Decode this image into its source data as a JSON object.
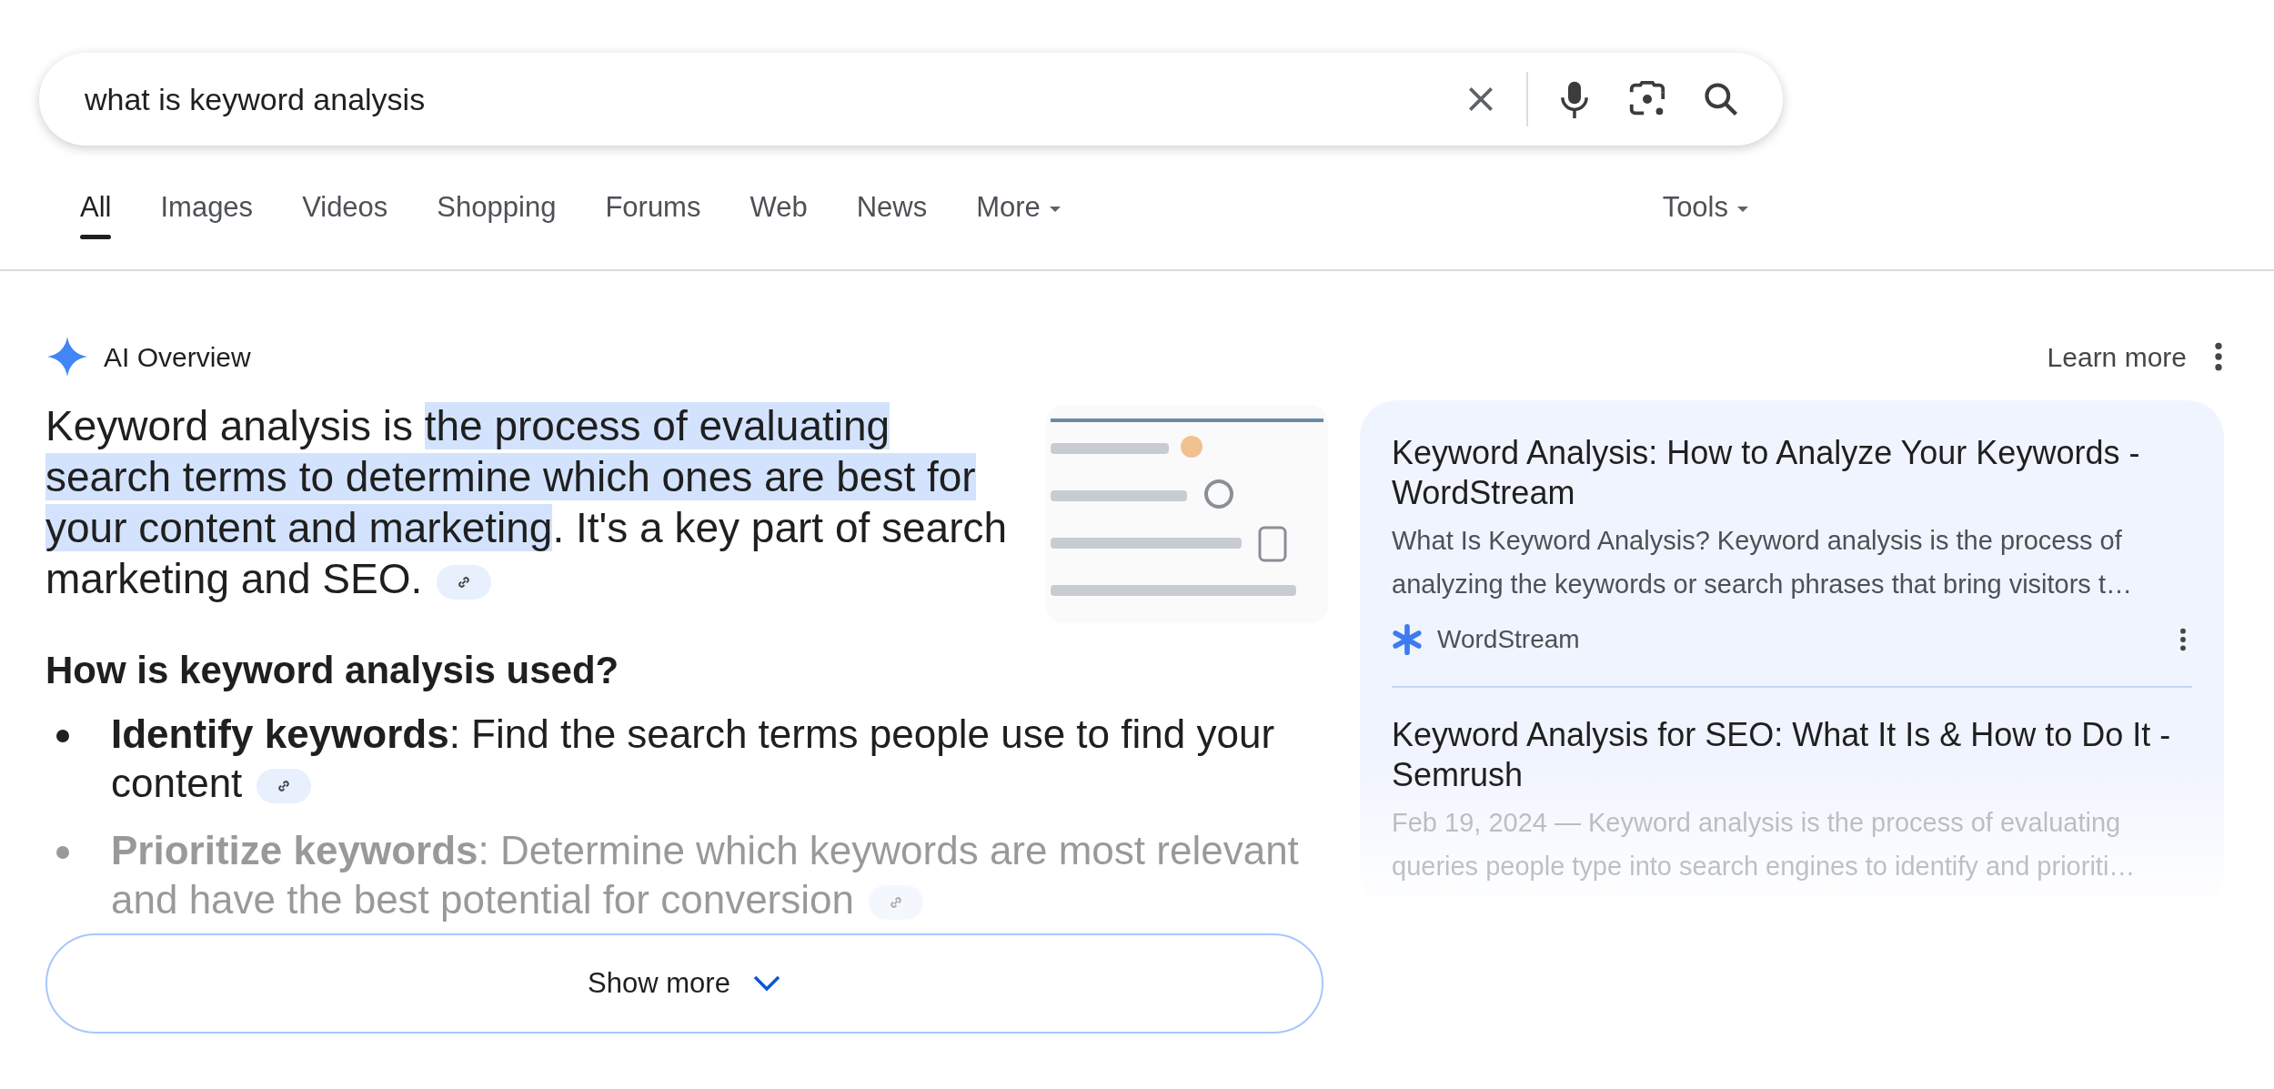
{
  "search": {
    "value": "what is keyword analysis"
  },
  "tabs": [
    {
      "label": "All",
      "selected": true,
      "kind": "plain"
    },
    {
      "label": "Images",
      "selected": false,
      "kind": "plain"
    },
    {
      "label": "Videos",
      "selected": false,
      "kind": "plain"
    },
    {
      "label": "Shopping",
      "selected": false,
      "kind": "plain"
    },
    {
      "label": "Forums",
      "selected": false,
      "kind": "plain"
    },
    {
      "label": "Web",
      "selected": false,
      "kind": "plain"
    },
    {
      "label": "News",
      "selected": false,
      "kind": "plain"
    },
    {
      "label": "More",
      "selected": false,
      "kind": "dropdown"
    }
  ],
  "tools": {
    "label": "Tools"
  },
  "ai_overview": {
    "title": "AI Overview",
    "learn_more": "Learn more",
    "summary": [
      {
        "text": "Keyword analysis is ",
        "highlighted": false
      },
      {
        "text": "the process of evaluating search terms to determine which ones are best for your content and marketing",
        "highlighted": true
      },
      {
        "text": ". It's a key part of search marketing and SEO.",
        "highlighted": false
      }
    ],
    "heading": "How is keyword analysis used?",
    "bullets": [
      "**Identify keywords**: Find the search terms people use to find your content",
      "**Prioritize keywords**: Determine which keywords are most relevant and have the best potential for conversion"
    ],
    "show_more": "Show more",
    "sources": [
      {
        "title": "Keyword Analysis: How to Analyze Your Keywords - WordStream",
        "snippet": "What Is Keyword Analysis? Keyword analysis is the process of analyzing the keywords or search phrases that bring visitors t…",
        "site": "WordStream"
      },
      {
        "title": "Keyword Analysis for SEO: What It Is & How to Do It - Semrush",
        "snippet": "Feb 19, 2024 — Keyword analysis is the process of evaluating queries people type into search engines to identify and prioriti…"
      }
    ]
  }
}
